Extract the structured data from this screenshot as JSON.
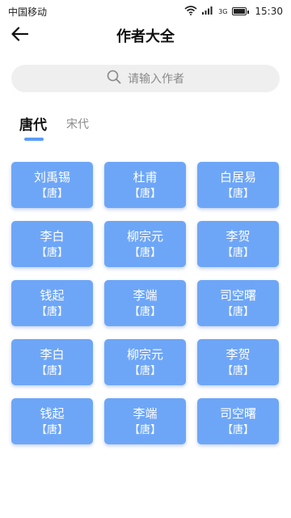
{
  "status": {
    "carrier": "中国移动",
    "network": "3G",
    "time": "15:30"
  },
  "header": {
    "title": "作者大全",
    "back_icon": "arrow-left-icon"
  },
  "search": {
    "placeholder": "请输入作者",
    "icon": "search-icon"
  },
  "tabs": [
    {
      "label": "唐代",
      "active": true
    },
    {
      "label": "宋代",
      "active": false
    }
  ],
  "authors": [
    {
      "name": "刘禹锡",
      "dynasty": "【唐】"
    },
    {
      "name": "杜甫",
      "dynasty": "【唐】"
    },
    {
      "name": "白居易",
      "dynasty": "【唐】"
    },
    {
      "name": "李白",
      "dynasty": "【唐】"
    },
    {
      "name": "柳宗元",
      "dynasty": "【唐】"
    },
    {
      "name": "李贺",
      "dynasty": "【唐】"
    },
    {
      "name": "钱起",
      "dynasty": "【唐】"
    },
    {
      "name": "李端",
      "dynasty": "【唐】"
    },
    {
      "name": "司空曙",
      "dynasty": "【唐】"
    },
    {
      "name": "李白",
      "dynasty": "【唐】"
    },
    {
      "name": "柳宗元",
      "dynasty": "【唐】"
    },
    {
      "name": "李贺",
      "dynasty": "【唐】"
    },
    {
      "name": "钱起",
      "dynasty": "【唐】"
    },
    {
      "name": "李端",
      "dynasty": "【唐】"
    },
    {
      "name": "司空曙",
      "dynasty": "【唐】"
    }
  ],
  "colors": {
    "card_bg": "#6ea6f7",
    "accent": "#5b9cf5",
    "search_bg": "#efefef"
  }
}
